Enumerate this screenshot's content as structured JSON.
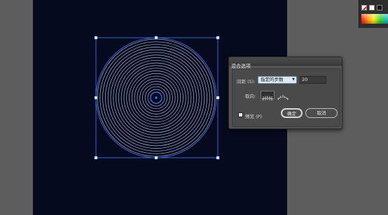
{
  "dialog": {
    "title": "混合选项",
    "spacing_label": "间距 (S):",
    "spacing_mode": "指定的步数",
    "spacing_value": "20",
    "orientation_label": "取向:",
    "preview_label": "预览 (P)",
    "preview_checked": false,
    "ok_label": "确定",
    "cancel_label": "取消"
  },
  "artwork": {
    "ring_count": 20,
    "ring_color": "#c8d4f0",
    "selection_color": "#4a78ff",
    "artboard_color": "#050a1e"
  },
  "swatches": [
    "none",
    "white",
    "black"
  ],
  "icons": {
    "orientation_page": "orient-page-icon",
    "orientation_path": "orient-path-icon"
  }
}
